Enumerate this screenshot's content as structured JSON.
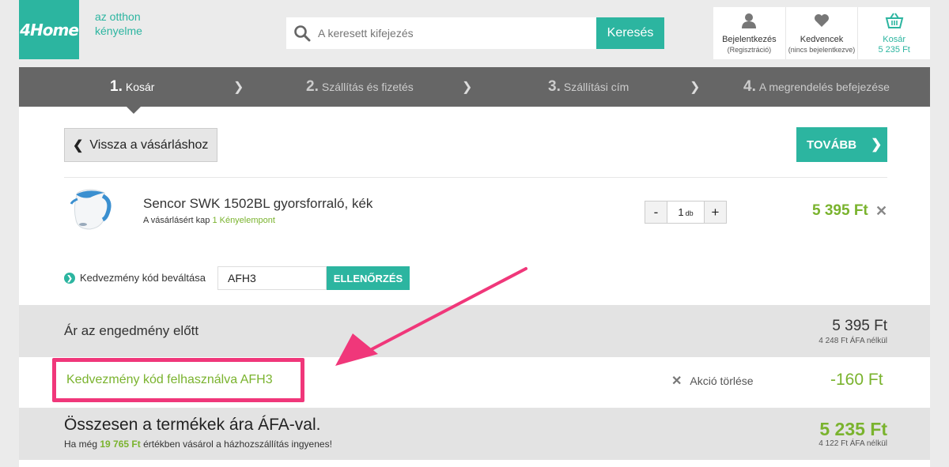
{
  "header": {
    "logo": "4Home",
    "tagline": "az otthon kényelme",
    "search_placeholder": "A keresett kifejezés",
    "search_button": "Keresés",
    "login_label": "Bejelentkezés",
    "login_sub": "(Regisztráció)",
    "favorites_label": "Kedvencek",
    "favorites_sub": "(nincs bejelentkezve)",
    "cart_label": "Kosár",
    "cart_total": "5 235 Ft"
  },
  "steps": [
    {
      "num": "1.",
      "label": "Kosár"
    },
    {
      "num": "2.",
      "label": "Szállítás és fizetés"
    },
    {
      "num": "3.",
      "label": "Szállítási cím"
    },
    {
      "num": "4.",
      "label": "A megrendelés befejezése"
    }
  ],
  "actions": {
    "back": "Vissza a vásárláshoz",
    "next": "TOVÁBB"
  },
  "product": {
    "name": "Sencor SWK 1502BL gyorsforraló, kék",
    "points_prefix": "A vásárlásért kap",
    "points": "1 Kényelempont",
    "qty": "1",
    "qty_unit": "db",
    "price": "5 395 Ft"
  },
  "coupon": {
    "label": "Kedvezmény kód beváltása",
    "value": "AFH3",
    "button": "ELLENŐRZÉS"
  },
  "summary": {
    "before_label": "Ár az engedmény előtt",
    "before_amount": "5 395 Ft",
    "before_net": "4 248 Ft ÁFA nélkül",
    "discount_label": "Kedvezmény kód felhasználva AFH3",
    "cancel_label": "Akció törlése",
    "discount_amount": "-160 Ft",
    "total_label": "Összesen a termékek ára ÁFA-val.",
    "free_prefix": "Ha még",
    "free_amount": "19 765 Ft",
    "free_suffix": "értékben vásárol a házhozszállítás ingyenes!",
    "total_amount": "5 235 Ft",
    "total_net": "4 122 Ft ÁFA nélkül"
  },
  "colors": {
    "teal": "#2cb5a0",
    "green": "#7ab32e",
    "highlight": "#f0377a"
  }
}
